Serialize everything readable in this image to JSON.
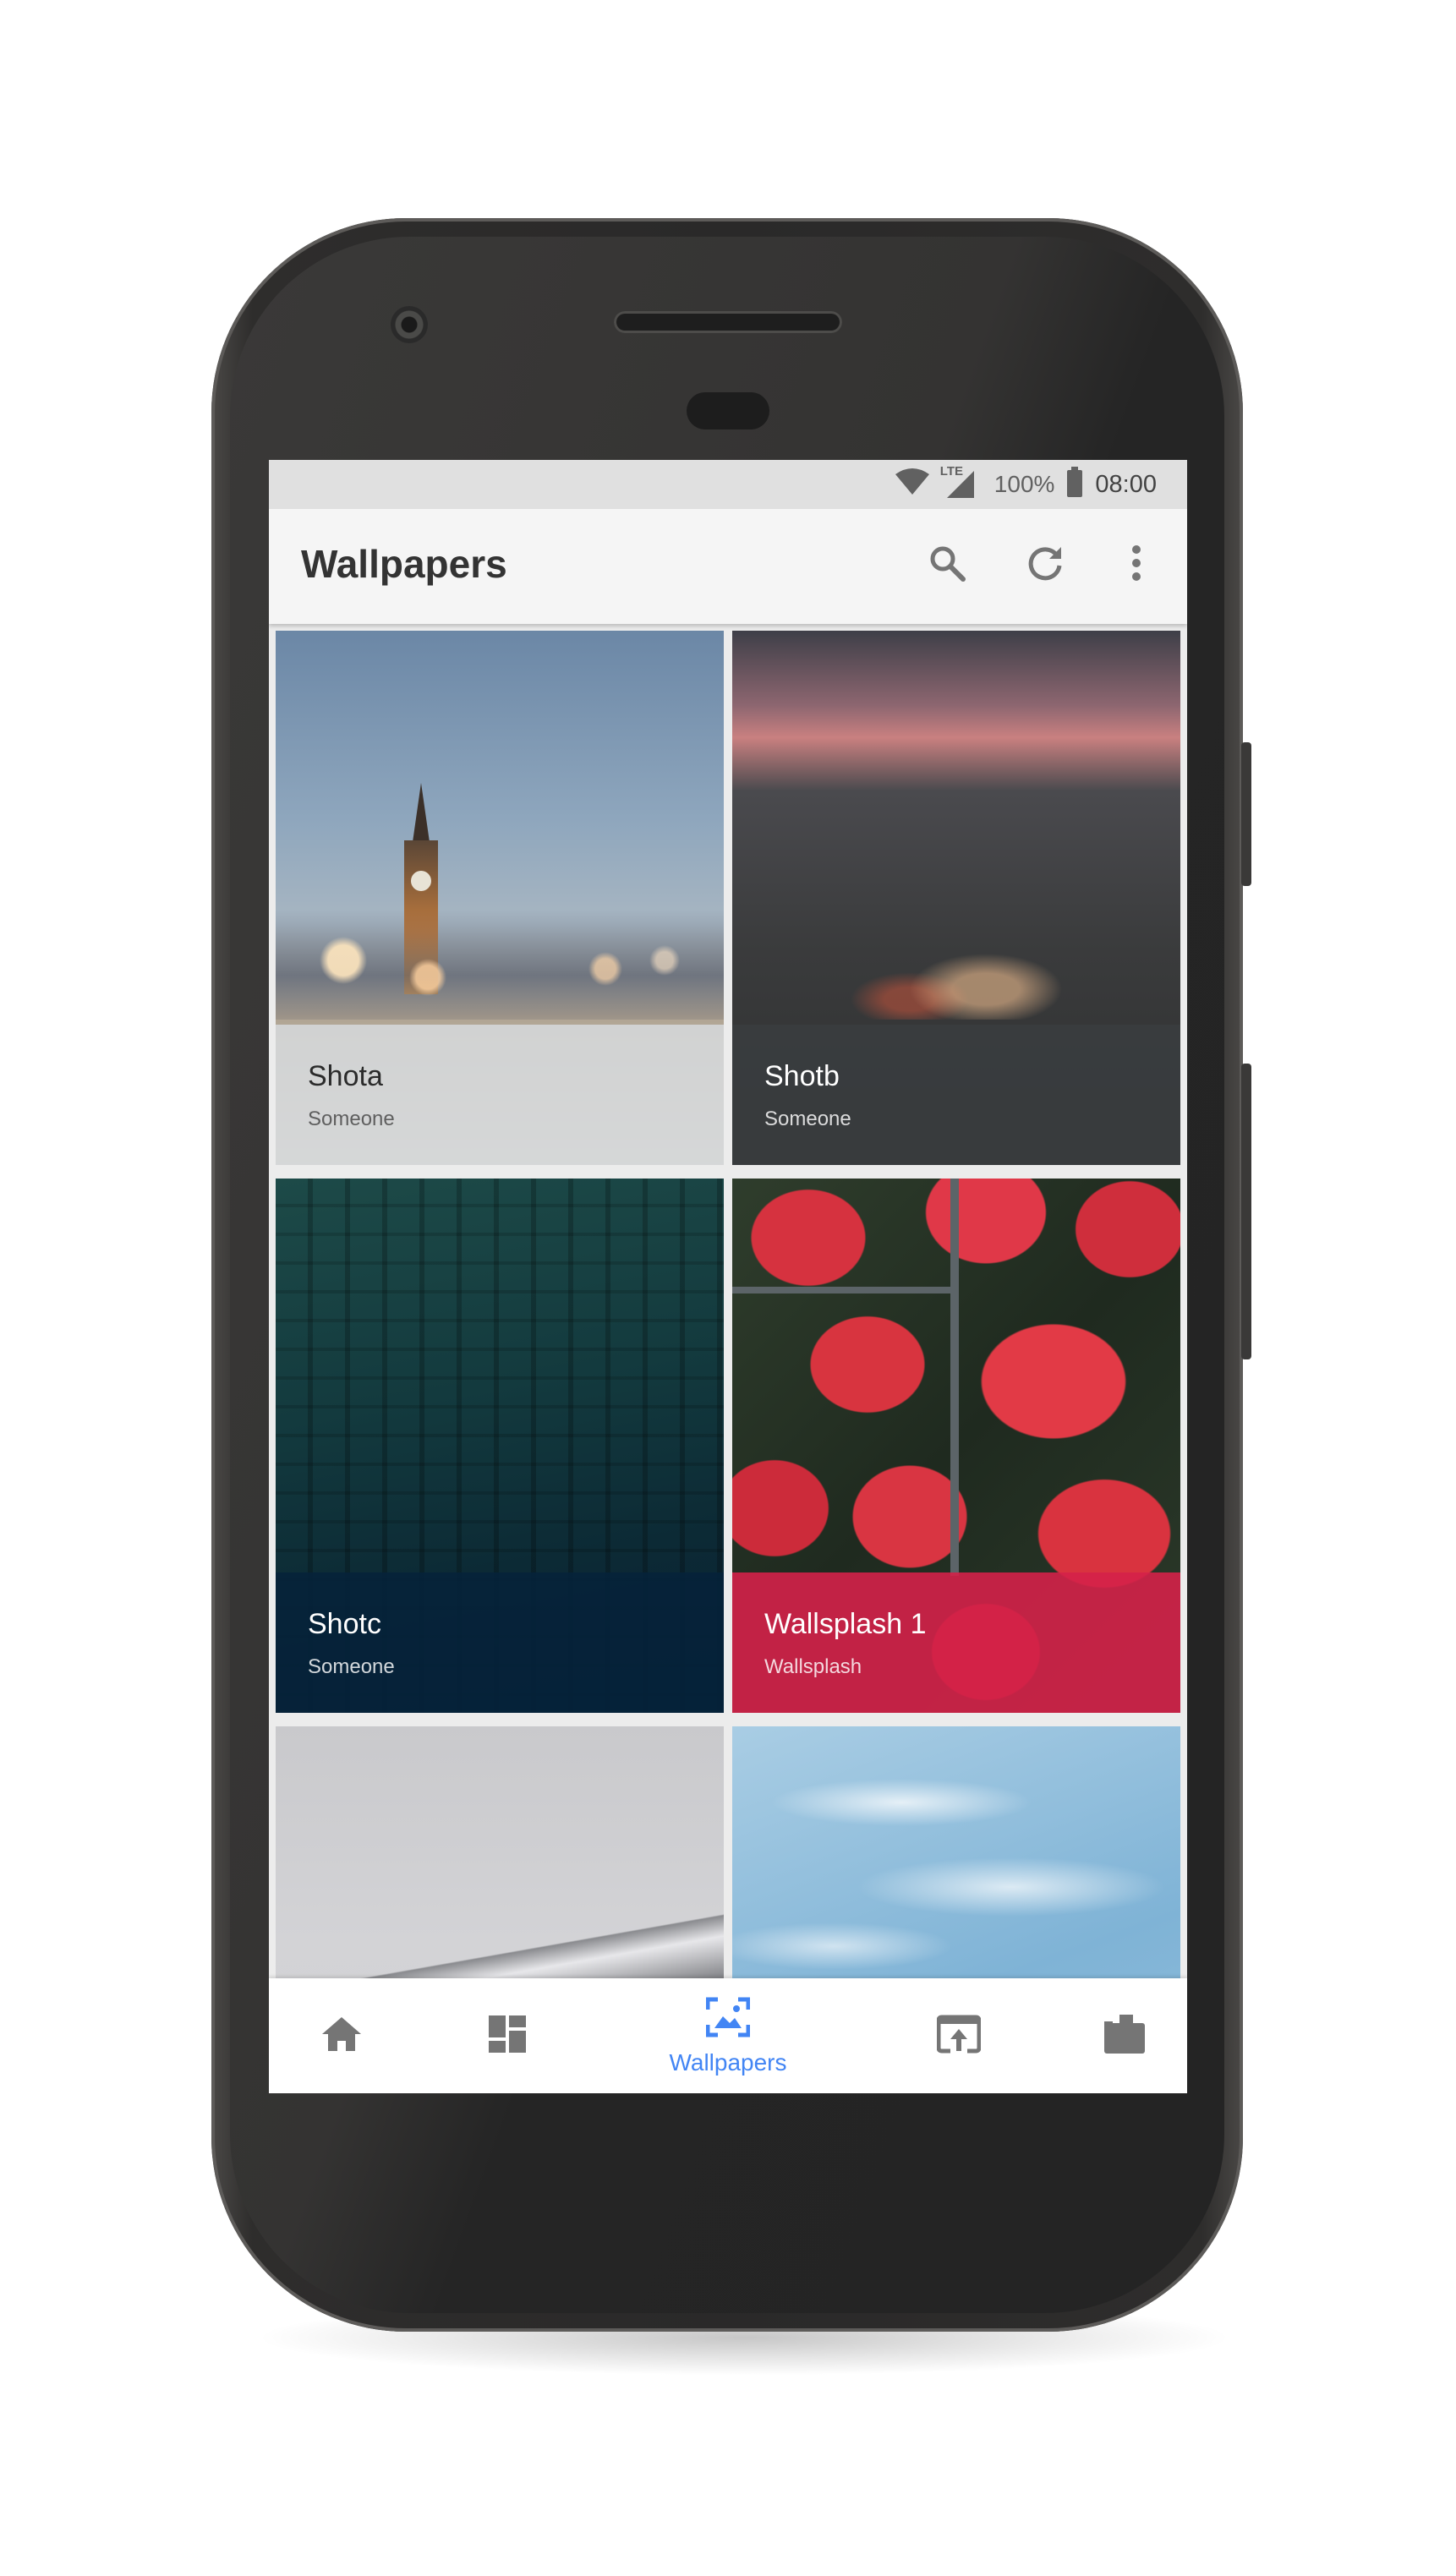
{
  "status_bar": {
    "battery": "100%",
    "time": "08:00",
    "network": "LTE"
  },
  "app_bar": {
    "title": "Wallpapers",
    "actions": [
      "search-icon",
      "refresh-icon",
      "more-vert-icon"
    ]
  },
  "wallpapers": [
    {
      "name": "Shota",
      "author": "Someone",
      "caption_color": "#d8dcdf"
    },
    {
      "name": "Shotb",
      "author": "Someone",
      "caption_color": "#3a3d3f"
    },
    {
      "name": "Shotc",
      "author": "Someone",
      "caption_color": "#06223a"
    },
    {
      "name": "Wallsplash 1",
      "author": "Wallsplash",
      "caption_color": "#d42149"
    },
    {
      "name": "",
      "author": ""
    },
    {
      "name": "",
      "author": ""
    }
  ],
  "bottom_nav": {
    "items": [
      {
        "icon": "home-icon",
        "label": ""
      },
      {
        "icon": "dashboard-icon",
        "label": ""
      },
      {
        "icon": "wallpaper-icon",
        "label": "Wallpapers",
        "selected": true
      },
      {
        "icon": "apply-icon",
        "label": ""
      },
      {
        "icon": "briefcase-icon",
        "label": ""
      }
    ]
  },
  "colors": {
    "accent": "#4285f4",
    "icon_gray": "#757575",
    "app_bar_bg": "#f5f5f5"
  }
}
